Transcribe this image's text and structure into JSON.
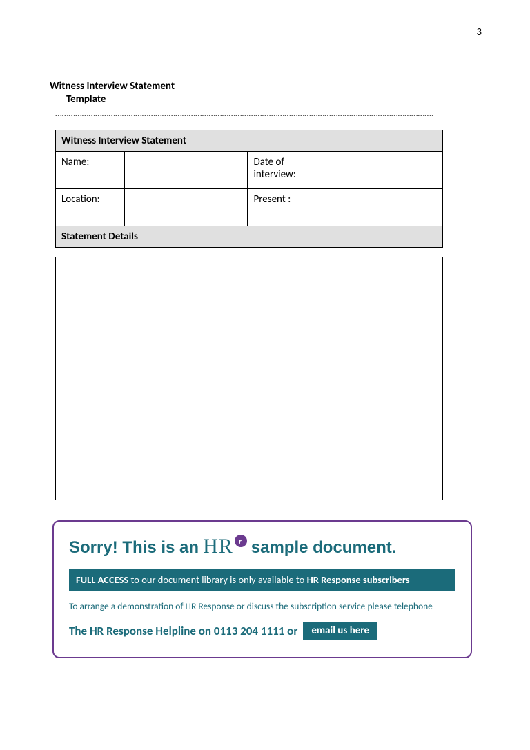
{
  "pageNumber": "3",
  "title": "Witness Interview Statement",
  "subtitle": "Template",
  "dottedLine": "…………………………………………………………………………………….……………………………………………………………….",
  "form": {
    "header": "Witness Interview Statement",
    "nameLabel": "Name:",
    "dateLabel": "Date of interview:",
    "locationLabel": "Location:",
    "presentLabel": "Present :",
    "sectionHeader": "Statement Details"
  },
  "promo": {
    "headline_a": "Sorry! This is an",
    "hr_text": "HR",
    "hr_badge": "r",
    "headline_b": "sample document.",
    "access_bold1": "FULL ACCESS",
    "access_mid": " to our document library is only available to ",
    "access_bold2": "HR Response subscribers",
    "demo": "To arrange a demonstration of HR Response or discuss the subscription service please telephone",
    "helpline": "The HR Response Helpline on 0113 204 1111 or",
    "email_btn": "email us here"
  }
}
